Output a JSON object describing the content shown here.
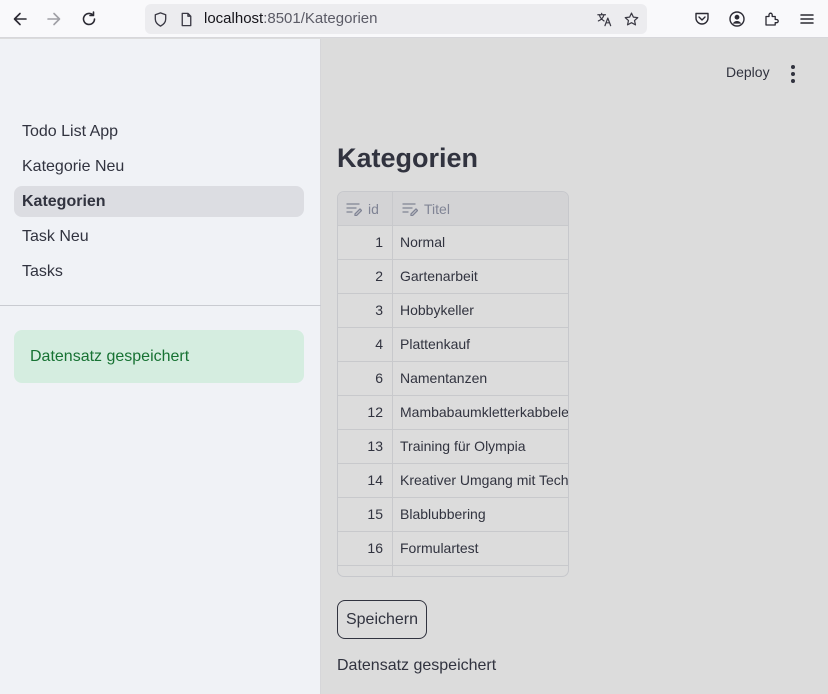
{
  "browser": {
    "url_host": "localhost",
    "url_path": ":8501/Kategorien"
  },
  "sidebar": {
    "items": [
      {
        "label": "Todo List App",
        "active": false
      },
      {
        "label": "Kategorie Neu",
        "active": false
      },
      {
        "label": "Kategorien",
        "active": true
      },
      {
        "label": "Task Neu",
        "active": false
      },
      {
        "label": "Tasks",
        "active": false
      }
    ],
    "alert": "Datensatz gespeichert"
  },
  "header": {
    "deploy_label": "Deploy"
  },
  "main": {
    "title": "Kategorien",
    "table": {
      "columns": [
        "id",
        "Titel"
      ],
      "rows": [
        {
          "id": "1",
          "titel": "Normal"
        },
        {
          "id": "2",
          "titel": "Gartenarbeit"
        },
        {
          "id": "3",
          "titel": "Hobbykeller"
        },
        {
          "id": "4",
          "titel": "Plattenkauf"
        },
        {
          "id": "6",
          "titel": "Namentanzen"
        },
        {
          "id": "12",
          "titel": "Mambabaumkletterkabbelei"
        },
        {
          "id": "13",
          "titel": "Training für Olympia"
        },
        {
          "id": "14",
          "titel": "Kreativer Umgang mit Technik"
        },
        {
          "id": "15",
          "titel": "Blablubbering"
        },
        {
          "id": "16",
          "titel": "Formulartest"
        },
        {
          "id": "",
          "titel": ""
        }
      ]
    },
    "save_label": "Speichern",
    "status_text": "Datensatz gespeichert"
  }
}
